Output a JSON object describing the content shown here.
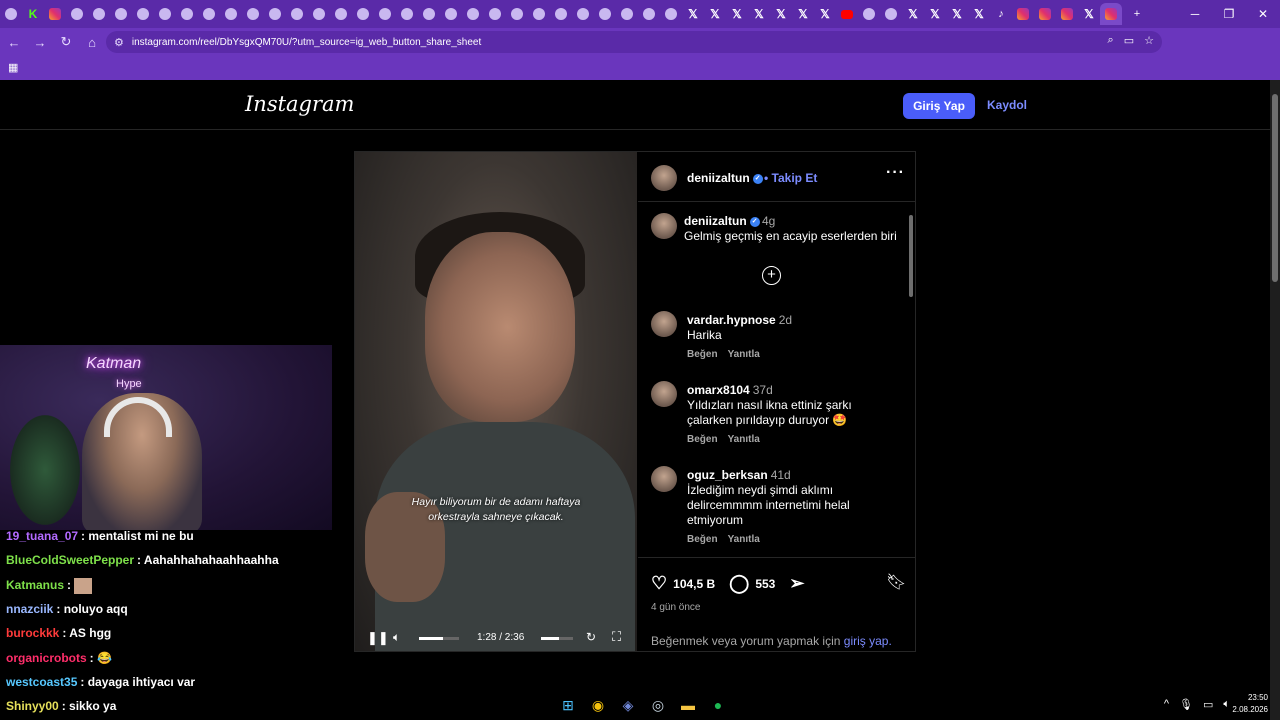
{
  "browser": {
    "url": "instagram.com/reel/DbYsgxQM70U/?utm_source=ig_web_button_share_sheet",
    "tabs": [
      "tab",
      "tab",
      "tab",
      "tab",
      "tab",
      "tab",
      "tab",
      "tab",
      "tab",
      "tab",
      "tab",
      "tab",
      "tab",
      "tab",
      "tab",
      "tab",
      "tab",
      "tab",
      "tab",
      "tab",
      "tab",
      "tab",
      "tab",
      "tab",
      "tab",
      "tab",
      "tab",
      "tab",
      "tab",
      "tab",
      "tab",
      "tab",
      "tab",
      "tab",
      "tab",
      "tab",
      "tab",
      "tab",
      "tab",
      "tab",
      "tab",
      "tab",
      "tab",
      "tab",
      "tab",
      "tab",
      "tab",
      "tab",
      "tab",
      "tab"
    ],
    "accent": "#6a36bd"
  },
  "header": {
    "logo": "Instagram",
    "login_label": "Giriş Yap",
    "signup_label": "Kaydol"
  },
  "post": {
    "username": "deniizaltun",
    "follow_label": "Takip Et",
    "more_label": "···",
    "caption": {
      "user": "deniizaltun",
      "time": "4g",
      "text": "Gelmiş geçmiş en acayip eserlerden biri"
    },
    "subtitle_line1": "Hayır biliyorum bir de adamı haftaya",
    "subtitle_line2": "orkestrayla sahneye çıkacak.",
    "video_time": "1:28 / 2:36",
    "comments": [
      {
        "user": "vardar.hypnose",
        "time": "2d",
        "text": "Harika",
        "like": "Beğen",
        "reply": "Yanıtla"
      },
      {
        "user": "omarx8104",
        "time": "37d",
        "text": "Yıldızları nasıl ikna ettiniz şarkı çalarken pırıldayıp duruyor 🤩",
        "like": "Beğen",
        "reply": "Yanıtla"
      },
      {
        "user": "oguz_berksan",
        "time": "41d",
        "text": "İzlediğim neydi şimdi aklımı delircemmmm internetimi helal etmiyorum",
        "like": "Beğen",
        "reply": "Yanıtla"
      }
    ],
    "likes": "104,5 B",
    "comment_count": "553",
    "ago": "4 gün önce",
    "login_hint": "Beğenmek veya yorum yapmak için",
    "login_link": "giriş yap."
  },
  "stream": {
    "neon_title": "Katman",
    "neon_sub": "Hype",
    "chat": [
      {
        "user": "19_tuana_07",
        "color": "#b36bff",
        "text": ": mentalist mi ne bu"
      },
      {
        "user": "BlueColdSweetPepper",
        "color": "#7ee04a",
        "text": ": Aahahhahahaahhaahha"
      },
      {
        "user": "Katmanus",
        "color": "#7ee04a",
        "text": ":"
      },
      {
        "user": "nnazciik",
        "color": "#9ab8ff",
        "text": ": noluyo aqq"
      },
      {
        "user": "burockkk",
        "color": "#ff3b3b",
        "text": ": AS hgg"
      },
      {
        "user": "organicrobots",
        "color": "#ff2e6a",
        "text": ": 😂"
      },
      {
        "user": "westcoast35",
        "color": "#57c8ff",
        "text": ": dayaga ihtiyacı var"
      },
      {
        "user": "Shinyy00",
        "color": "#e6e05a",
        "text": ": sikko ya"
      }
    ]
  },
  "taskbar": {
    "time": "23:50",
    "date": "2.08.2026"
  }
}
